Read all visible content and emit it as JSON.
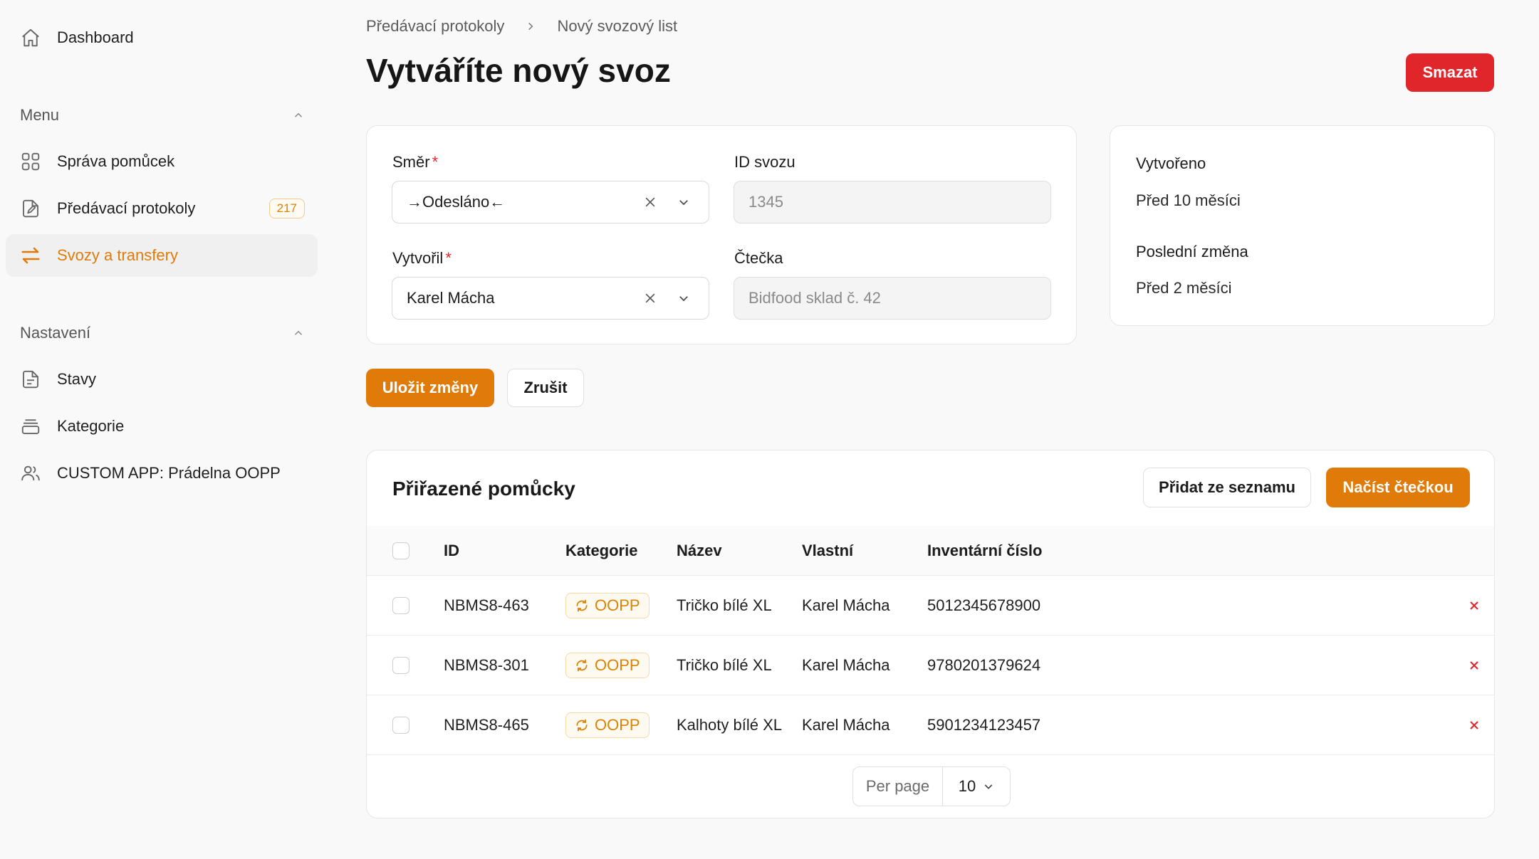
{
  "sidebar": {
    "dashboard": "Dashboard",
    "menu_heading": "Menu",
    "menu_items": [
      {
        "label": "Správa pomůcek",
        "icon": "grid-icon"
      },
      {
        "label": "Předávací protokoly",
        "icon": "document-edit-icon",
        "badge": "217"
      },
      {
        "label": "Svozy a transfery",
        "icon": "transfer-arrows-icon",
        "active": true
      }
    ],
    "settings_heading": "Nastavení",
    "settings_items": [
      {
        "label": "Stavy",
        "icon": "file-icon"
      },
      {
        "label": "Kategorie",
        "icon": "archive-box-icon"
      },
      {
        "label": "CUSTOM APP: Prádelna OOPP",
        "icon": "users-icon"
      }
    ]
  },
  "breadcrumb": {
    "parent": "Předávací protokoly",
    "current": "Nový svozový list"
  },
  "header": {
    "title": "Vytváříte nový svoz",
    "delete_label": "Smazat"
  },
  "form": {
    "direction_label": "Směr",
    "direction_value": "→Odesláno←",
    "pickup_id_label": "ID svozu",
    "pickup_id_placeholder": "1345",
    "creator_label": "Vytvořil",
    "creator_value": "Karel Mácha",
    "reader_label": "Čtečka",
    "reader_placeholder": "Bidfood sklad č. 42",
    "required_mark": "*"
  },
  "meta": {
    "created_label": "Vytvořeno",
    "created_value": "Před 10 měsíci",
    "modified_label": "Poslední změna",
    "modified_value": "Před 2 měsíci"
  },
  "actions": {
    "save_label": "Uložit změny",
    "cancel_label": "Zrušit"
  },
  "items": {
    "title": "Přiřazené pomůcky",
    "add_from_list_label": "Přidat ze seznamu",
    "scan_label": "Načíst čtečkou",
    "columns": [
      "ID",
      "Kategorie",
      "Název",
      "Vlastní",
      "Inventární číslo"
    ],
    "rows": [
      {
        "id": "NBMS8-463",
        "category": "OOPP",
        "name": "Tričko bílé XL",
        "owner": "Karel Mácha",
        "inventory": "5012345678900"
      },
      {
        "id": "NBMS8-301",
        "category": "OOPP",
        "name": "Tričko bílé XL",
        "owner": "Karel Mácha",
        "inventory": "9780201379624"
      },
      {
        "id": "NBMS8-465",
        "category": "OOPP",
        "name": "Kalhoty bílé XL",
        "owner": "Karel Mácha",
        "inventory": "5901234123457"
      }
    ],
    "per_page_label": "Per page",
    "per_page_value": "10"
  },
  "colors": {
    "accent": "#e07b0a",
    "danger": "#e0262b",
    "background": "#f9f9f9"
  }
}
